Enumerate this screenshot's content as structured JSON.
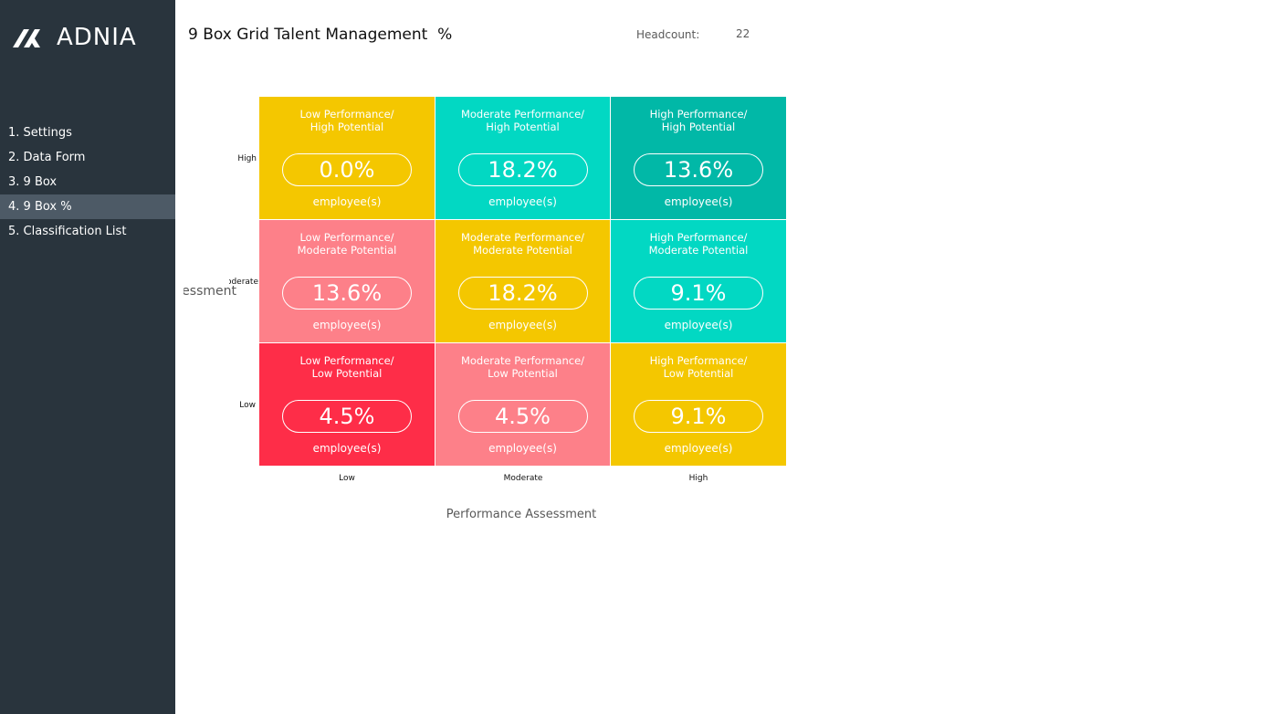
{
  "app": {
    "logo_text": "ADNIA"
  },
  "sidebar": {
    "items": [
      {
        "label": "1. Settings",
        "active": false
      },
      {
        "label": "2. Data Form",
        "active": false
      },
      {
        "label": "3. 9 Box",
        "active": false
      },
      {
        "label": "4. 9 Box %",
        "active": true
      },
      {
        "label": "5. Classification List",
        "active": false
      }
    ]
  },
  "header": {
    "title": "9 Box Grid Talent Management  %",
    "headcount_label": "Headcount:",
    "headcount_value": "22"
  },
  "chart_data": {
    "type": "table",
    "title": "9 Box Grid Talent Management  %",
    "xlabel": "Performance Assessment",
    "ylabel": "Potential Assessment",
    "x_ticks": [
      "Low",
      "Moderate",
      "High"
    ],
    "y_ticks": [
      "High",
      "Moderate",
      "Low"
    ],
    "cell_unit": "employee(s)",
    "cells": [
      {
        "title": "Low Performance/\nHigh Potential",
        "value": "0.0%",
        "color": "#f4c700"
      },
      {
        "title": "Moderate Performance/\nHigh Potential",
        "value": "18.2%",
        "color": "#02d8c3"
      },
      {
        "title": "High Performance/\nHigh Potential",
        "value": "13.6%",
        "color": "#01b8a7"
      },
      {
        "title": "Low Performance/\nModerate Potential",
        "value": "13.6%",
        "color": "#fd8089"
      },
      {
        "title": "Moderate Performance/\nModerate Potential",
        "value": "18.2%",
        "color": "#f4c700"
      },
      {
        "title": "High Performance/\nModerate Potential",
        "value": "9.1%",
        "color": "#02d8c3"
      },
      {
        "title": "Low Performance/\nLow Potential",
        "value": "4.5%",
        "color": "#fe2d48"
      },
      {
        "title": "Moderate Performance/\nLow Potential",
        "value": "4.5%",
        "color": "#fd8089"
      },
      {
        "title": "High Performance/\nLow Potential",
        "value": "9.1%",
        "color": "#f4c700"
      }
    ]
  },
  "colors": {
    "sidebar_bg": "#29343d",
    "sidebar_active": "#4d5a66"
  },
  "icons": {
    "logo": "adnia-logo-icon"
  }
}
